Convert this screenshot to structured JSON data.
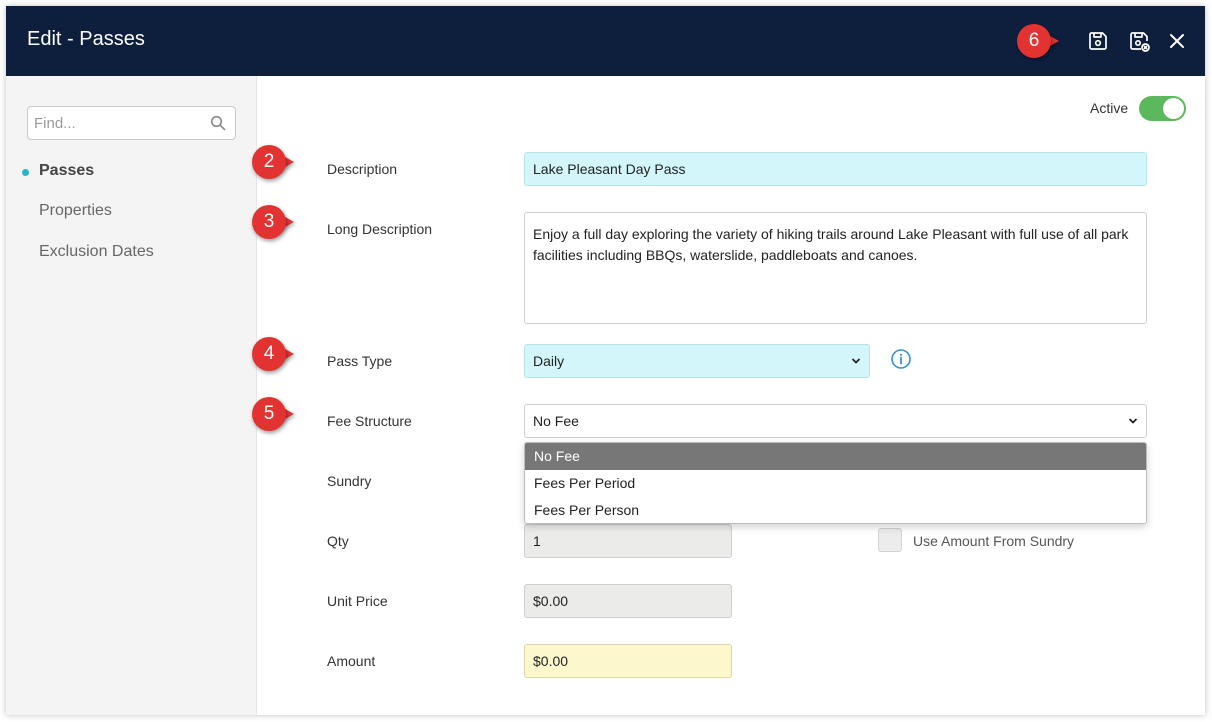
{
  "window": {
    "title": "Edit - Passes"
  },
  "callouts": [
    "2",
    "3",
    "4",
    "5",
    "6"
  ],
  "toolbar": {
    "icons": [
      "save-icon",
      "save-close-icon",
      "close-icon"
    ]
  },
  "sidebar": {
    "search": {
      "placeholder": "Find...",
      "value": ""
    },
    "items": [
      {
        "label": "Passes",
        "active": true
      },
      {
        "label": "Properties",
        "active": false
      },
      {
        "label": "Exclusion Dates",
        "active": false
      }
    ]
  },
  "form": {
    "active_label": "Active",
    "active": true,
    "description": {
      "label": "Description",
      "value": "Lake Pleasant Day Pass"
    },
    "long_description": {
      "label": "Long Description",
      "value": "Enjoy a full day exploring the variety of hiking trails around Lake Pleasant with full use of all park facilities including BBQs, waterslide, paddleboats and canoes."
    },
    "pass_type": {
      "label": "Pass Type",
      "value": "Daily"
    },
    "fee_structure": {
      "label": "Fee Structure",
      "value": "No Fee",
      "options": [
        "No Fee",
        "Fees Per Period",
        "Fees Per Person"
      ]
    },
    "sundry": {
      "label": "Sundry"
    },
    "qty": {
      "label": "Qty",
      "value": "1"
    },
    "use_amount_from_sundry": {
      "label": "Use Amount From Sundry",
      "checked": false
    },
    "unit_price": {
      "label": "Unit Price",
      "value": "$0.00"
    },
    "amount": {
      "label": "Amount",
      "value": "$0.00"
    }
  },
  "colors": {
    "titlebar": "#0e1f3d",
    "callout": "#e33232",
    "toggle_on": "#5cb85c",
    "required_field": "#d3f6fa",
    "amount_field": "#fdf8cc",
    "nav_dot": "#2bb3c9"
  }
}
